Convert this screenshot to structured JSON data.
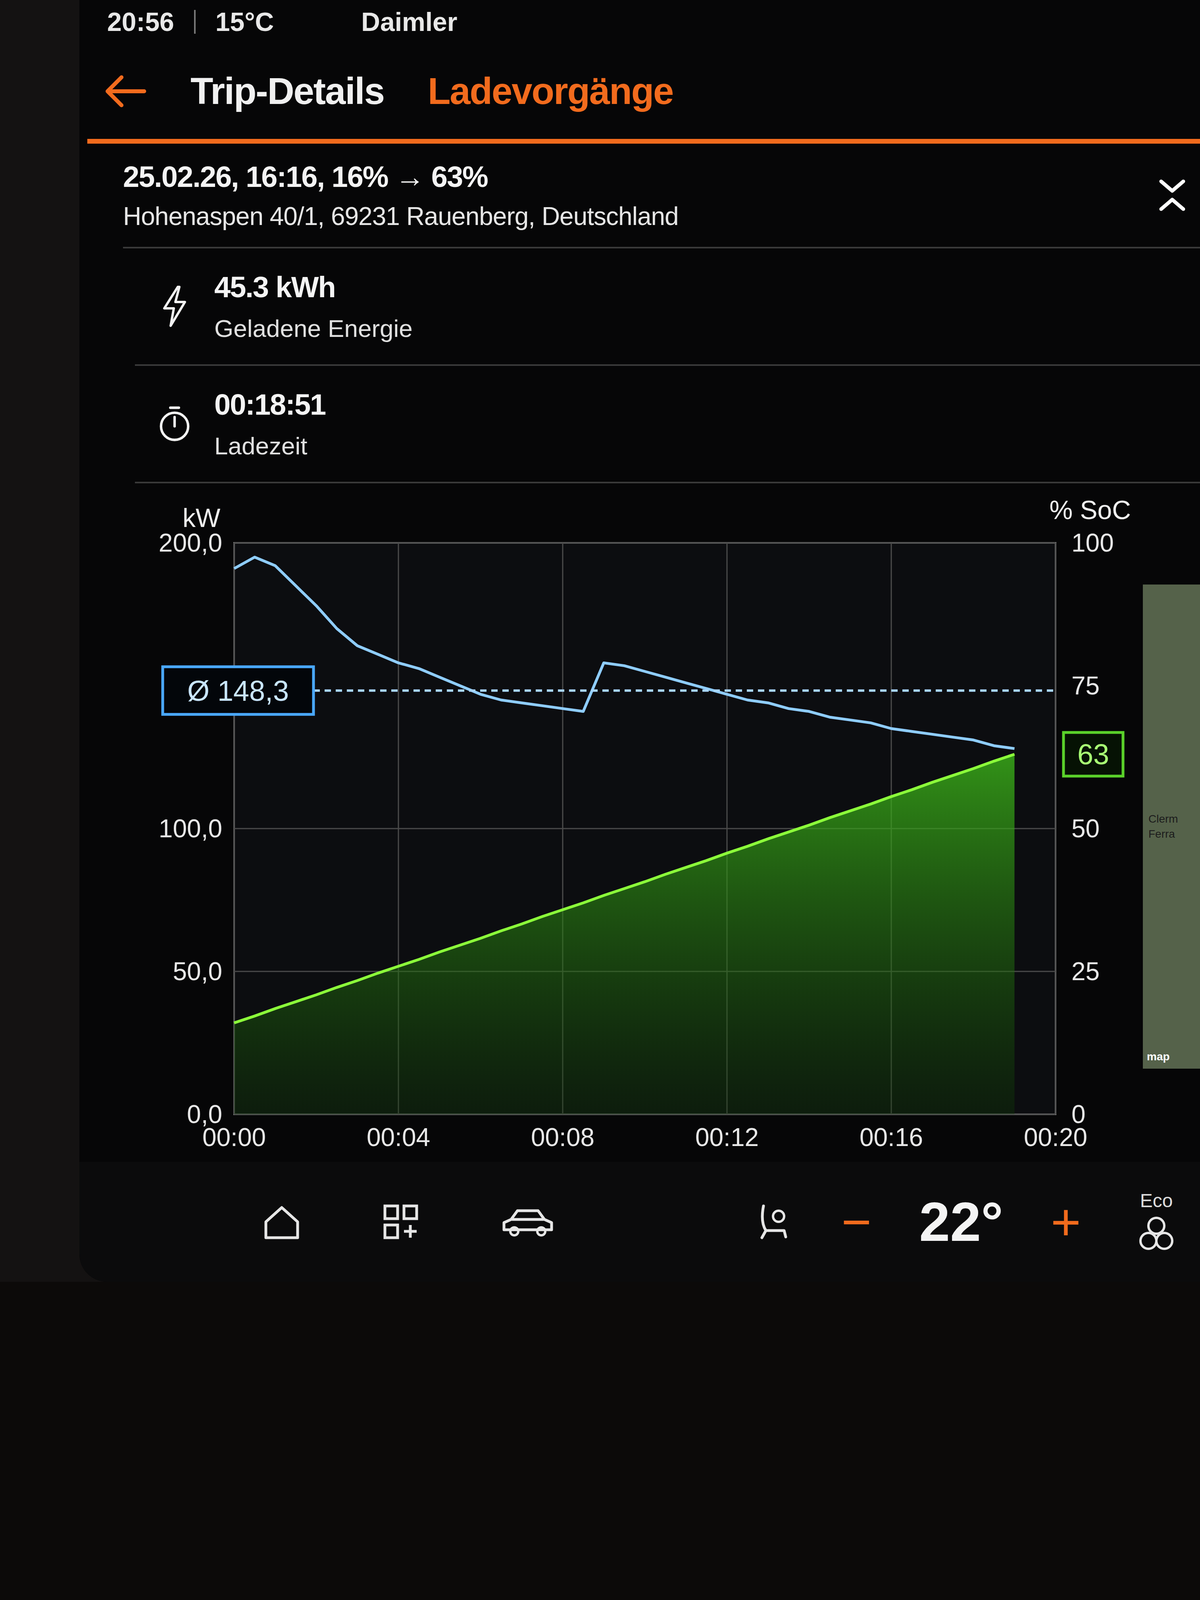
{
  "status_bar": {
    "time": "20:56",
    "temperature": "15°C",
    "profile": "Daimler"
  },
  "tabs": [
    {
      "label": "Trip-Details",
      "selected": false
    },
    {
      "label": "Ladevorgänge",
      "selected": true
    }
  ],
  "session": {
    "title": "25.02.26, 16:16, 16% → 63%",
    "address": "Hohenaspen 40/1, 69231 Rauenberg, Deutschland"
  },
  "stats": [
    {
      "value": "45.3 kWh",
      "label": "Geladene Energie",
      "kind": "energy"
    },
    {
      "value": "00:18:51",
      "label": "Ladezeit",
      "kind": "time"
    }
  ],
  "chart": {
    "left_axis_title": "kW",
    "right_axis_title": "% SoC",
    "left_ticks": [
      {
        "label": "200,0",
        "value": 200
      },
      {
        "label": "100,0",
        "value": 100
      },
      {
        "label": "50,0",
        "value": 50
      },
      {
        "label": "0,0",
        "value": 0
      }
    ],
    "right_ticks": [
      {
        "label": "100",
        "value": 100
      },
      {
        "label": "75",
        "value": 75
      },
      {
        "label": "50",
        "value": 50
      },
      {
        "label": "25",
        "value": 25
      },
      {
        "label": "0",
        "value": 0
      }
    ],
    "x_ticks": [
      "00:00",
      "00:04",
      "00:08",
      "00:12",
      "00:16",
      "00:20"
    ],
    "x_max_minutes": 20,
    "sample_interval_minutes": 0.5,
    "kw_max": 200,
    "power_kw": [
      191,
      195,
      192,
      185,
      178,
      170,
      164,
      161,
      158,
      156,
      153,
      150,
      147,
      145,
      144,
      143,
      142,
      141,
      158,
      157,
      155,
      153,
      151,
      149,
      147,
      145,
      144,
      142,
      141,
      139,
      138,
      137,
      135,
      134,
      133,
      132,
      131,
      129,
      128
    ],
    "soc_percent": [
      16,
      17.2,
      18.5,
      19.7,
      20.9,
      22.2,
      23.4,
      24.7,
      25.9,
      27.1,
      28.4,
      29.6,
      30.8,
      32.1,
      33.3,
      34.6,
      35.8,
      37,
      38.3,
      39.5,
      40.7,
      42,
      43.2,
      44.4,
      45.7,
      46.9,
      48.2,
      49.4,
      50.6,
      51.9,
      53.1,
      54.3,
      55.6,
      56.8,
      58.1,
      59.3,
      60.5,
      61.8,
      63
    ],
    "average_kw": 148.3,
    "average_label": "Ø 148,3",
    "soc_end_label": "63"
  },
  "map": {
    "labels": [
      "Clerm",
      "Ferra"
    ],
    "logo": "map"
  },
  "climate": {
    "minus": "−",
    "temperature": "22°",
    "plus": "+",
    "fan_mode": "Eco"
  }
}
